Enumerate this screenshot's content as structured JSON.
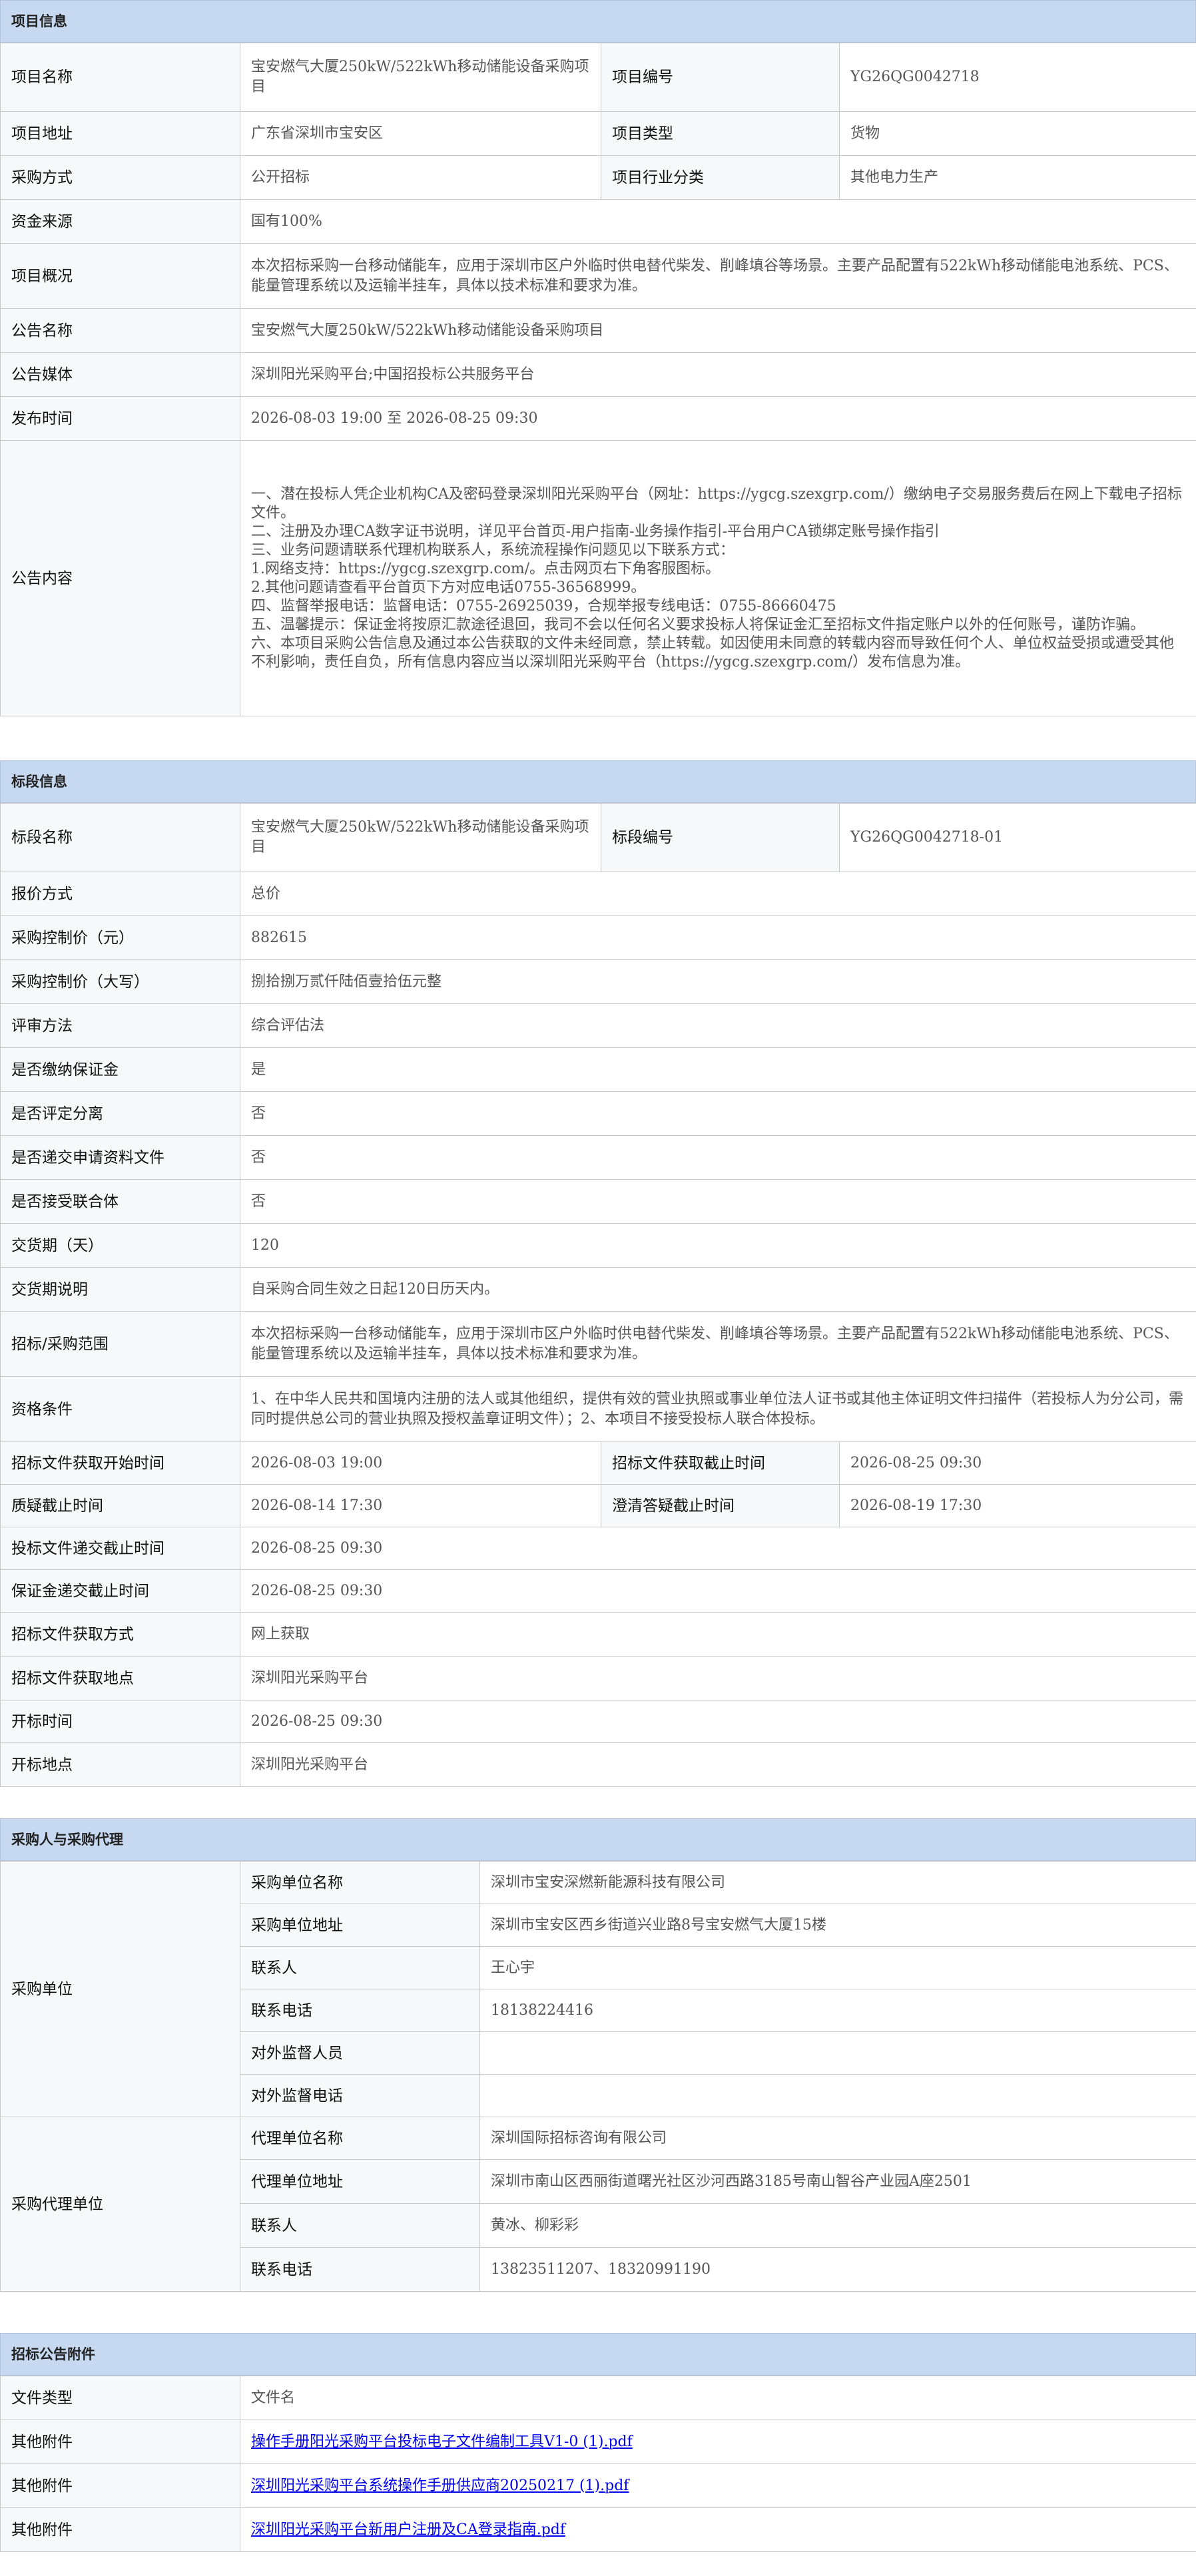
{
  "project_info": {
    "header": "项目信息",
    "project_name_label": "项目名称",
    "project_name": "宝安燃气大厦250kW/522kWh移动储能设备采购项目",
    "project_no_label": "项目编号",
    "project_no": "YG26QG0042718",
    "address_label": "项目地址",
    "address": "广东省深圳市宝安区",
    "type_label": "项目类型",
    "type": "货物",
    "method_label": "采购方式",
    "method": "公开招标",
    "industry_label": "项目行业分类",
    "industry": "其他电力生产",
    "fund_label": "资金来源",
    "fund": "国有100%",
    "overview_label": "项目概况",
    "overview": "本次招标采购一台移动储能车，应用于深圳市区户外临时供电替代柴发、削峰填谷等场景。主要产品配置有522kWh移动储能电池系统、PCS、能量管理系统以及运输半挂车，具体以技术标准和要求为准。",
    "notice_name_label": "公告名称",
    "notice_name": "宝安燃气大厦250kW/522kWh移动储能设备采购项目",
    "media_label": "公告媒体",
    "media": "深圳阳光采购平台;中国招投标公共服务平台",
    "publish_label": "发布时间",
    "publish": "2026-08-03 19:00 至 2026-08-25 09:30",
    "content_label": "公告内容",
    "content_lines": [
      "一、潜在投标人凭企业机构CA及密码登录深圳阳光采购平台（网址：https://ygcg.szexgrp.com/）缴纳电子交易服务费后在网上下载电子招标文件。",
      "二、注册及办理CA数字证书说明，详见平台首页-用户指南-业务操作指引-平台用户CA锁绑定账号操作指引",
      "三、业务问题请联系代理机构联系人，系统流程操作问题见以下联系方式：",
      "1.网络支持：https://ygcg.szexgrp.com/。点击网页右下角客服图标。",
      "2.其他问题请查看平台首页下方对应电话0755-36568999。",
      "四、监督举报电话：监督电话：0755-26925039，合规举报专线电话：0755-86660475",
      "五、温馨提示：保证金将按原汇款途径退回，我司不会以任何名义要求投标人将保证金汇至招标文件指定账户以外的任何账号，谨防诈骗。",
      "六、本项目采购公告信息及通过本公告获取的文件未经同意，禁止转载。如因使用未同意的转载内容而导致任何个人、单位权益受损或遭受其他不利影响，责任自负，所有信息内容应当以深圳阳光采购平台（https://ygcg.szexgrp.com/）发布信息为准。"
    ]
  },
  "lot_info": {
    "header": "标段信息",
    "lot_name_label": "标段名称",
    "lot_name": "宝安燃气大厦250kW/522kWh移动储能设备采购项目",
    "lot_no_label": "标段编号",
    "lot_no": "YG26QG0042718-01",
    "rows": [
      {
        "label": "报价方式",
        "value": "总价"
      },
      {
        "label": "采购控制价（元）",
        "value": "882615"
      },
      {
        "label": "采购控制价（大写）",
        "value": "捌拾捌万贰仟陆佰壹拾伍元整"
      },
      {
        "label": "评审方法",
        "value": "综合评估法"
      },
      {
        "label": "是否缴纳保证金",
        "value": "是"
      },
      {
        "label": "是否评定分离",
        "value": "否"
      },
      {
        "label": "是否递交申请资料文件",
        "value": "否"
      },
      {
        "label": "是否接受联合体",
        "value": "否"
      },
      {
        "label": "交货期（天）",
        "value": "120"
      },
      {
        "label": "交货期说明",
        "value": "自采购合同生效之日起120日历天内。"
      }
    ],
    "scope_label": "招标/采购范围",
    "scope": "本次招标采购一台移动储能车，应用于深圳市区户外临时供电替代柴发、削峰填谷等场景。主要产品配置有522kWh移动储能电池系统、PCS、能量管理系统以及运输半挂车，具体以技术标准和要求为准。",
    "qual_label": "资格条件",
    "qual": "1、在中华人民共和国境内注册的法人或其他组织，提供有效的营业执照或事业单位法人证书或其他主体证明文件扫描件（若投标人为分公司，需同时提供总公司的营业执照及授权盖章证明文件）；2、本项目不接受投标人联合体投标。",
    "doc_start_label": "招标文件获取开始时间",
    "doc_start": "2026-08-03 19:00",
    "doc_end_label": "招标文件获取截止时间",
    "doc_end": "2026-08-25 09:30",
    "query_end_label": "质疑截止时间",
    "query_end": "2026-08-14 17:30",
    "clarify_end_label": "澄清答疑截止时间",
    "clarify_end": "2026-08-19 17:30",
    "rows2": [
      {
        "label": "投标文件递交截止时间",
        "value": "2026-08-25 09:30"
      },
      {
        "label": "保证金递交截止时间",
        "value": "2026-08-25 09:30"
      },
      {
        "label": "招标文件获取方式",
        "value": "网上获取"
      },
      {
        "label": "招标文件获取地点",
        "value": "深圳阳光采购平台"
      },
      {
        "label": "开标时间",
        "value": "2026-08-25 09:30"
      },
      {
        "label": "开标地点",
        "value": "深圳阳光采购平台"
      }
    ]
  },
  "parties": {
    "header": "采购人与采购代理",
    "buyer_label": "采购单位",
    "buyer_rows": [
      {
        "label": "采购单位名称",
        "value": "深圳市宝安深燃新能源科技有限公司"
      },
      {
        "label": "采购单位地址",
        "value": "深圳市宝安区西乡街道兴业路8号宝安燃气大厦15楼"
      },
      {
        "label": "联系人",
        "value": "王心宇"
      },
      {
        "label": "联系电话",
        "value": "18138224416"
      },
      {
        "label": "对外监督人员",
        "value": ""
      },
      {
        "label": "对外监督电话",
        "value": ""
      }
    ],
    "agent_label": "采购代理单位",
    "agent_rows": [
      {
        "label": "代理单位名称",
        "value": "深圳国际招标咨询有限公司"
      },
      {
        "label": "代理单位地址",
        "value": "深圳市南山区西丽街道曙光社区沙河西路3185号南山智谷产业园A座2501"
      },
      {
        "label": "联系人",
        "value": "黄冰、柳彩彩"
      },
      {
        "label": "联系电话",
        "value": "13823511207、18320991190"
      }
    ]
  },
  "attachments": {
    "header": "招标公告附件",
    "col_type": "文件类型",
    "col_name": "文件名",
    "files": [
      {
        "type": "其他附件",
        "name": "操作手册阳光采购平台投标电子文件编制工具V1-0 (1).pdf"
      },
      {
        "type": "其他附件",
        "name": "深圳阳光采购平台系统操作手册供应商20250217 (1).pdf"
      },
      {
        "type": "其他附件",
        "name": "深圳阳光采购平台新用户注册及CA登录指南.pdf"
      }
    ]
  }
}
